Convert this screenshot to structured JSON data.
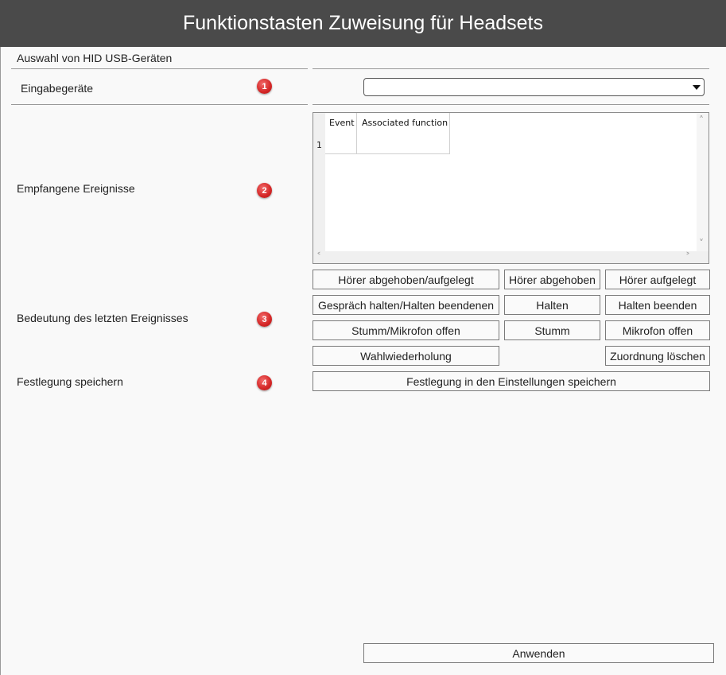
{
  "window": {
    "title": "Funktionstasten Zuweisung für Headsets"
  },
  "sections": {
    "hid_header": "Auswahl von HID USB-Geräten",
    "input_devices": {
      "label": "Eingabegeräte",
      "badge": "1",
      "selected": ""
    },
    "received_events": {
      "label": "Empfangene Ereignisse",
      "badge": "2",
      "columns": [
        "Event",
        "Associated function"
      ],
      "rows": [
        {
          "num": "1",
          "event": "",
          "function": ""
        }
      ]
    },
    "last_event_meaning": {
      "label": "Bedeutung des letzten Ereignisses",
      "badge": "3",
      "buttons": {
        "offhook_onhook": "Hörer abgehoben/aufgelegt",
        "offhook": "Hörer abgehoben",
        "onhook": "Hörer aufgelegt",
        "hold_toggle": "Gespräch halten/Halten beendenen",
        "hold": "Halten",
        "end_hold": "Halten beenden",
        "mute_toggle": "Stumm/Mikrofon offen",
        "mute": "Stumm",
        "mic_open": "Mikrofon offen",
        "redial": "Wahlwiederholung",
        "clear_mapping": "Zuordnung löschen"
      }
    },
    "save_settings": {
      "label": "Festlegung speichern",
      "badge": "4",
      "button": "Festlegung in den Einstellungen speichern"
    }
  },
  "footer": {
    "apply": "Anwenden"
  },
  "colors": {
    "titlebar": "#4a4a4a",
    "badge": "#d42626",
    "background": "#f9f9f9"
  }
}
